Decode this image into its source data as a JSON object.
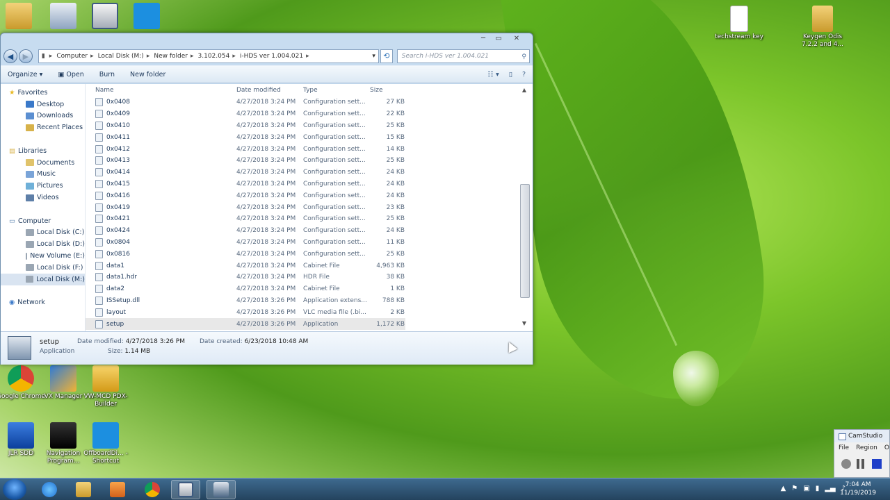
{
  "desktop": {
    "top_icons": [
      {
        "label": "",
        "icon": "user-folder-icon"
      },
      {
        "label": "",
        "icon": "printer-icon"
      },
      {
        "label": "",
        "icon": "camera-icon"
      },
      {
        "label": "",
        "icon": "e-app-icon"
      }
    ],
    "right_icons": [
      {
        "label": "techstream key",
        "icon": "text-file-icon"
      },
      {
        "label": "Keygen Odis 7.2.2 and 4...",
        "icon": "zip-folder-icon"
      }
    ],
    "left_icons": [
      {
        "label": "Google Chrome",
        "icon": "chrome-icon"
      },
      {
        "label": "VX Manager",
        "icon": "vx-manager-icon"
      },
      {
        "label": "VW-MCD PDX-Builder",
        "icon": "pdx-builder-icon"
      },
      {
        "label": "JLR SDD",
        "icon": "jlr-sdd-icon"
      },
      {
        "label": "Navigation Program...",
        "icon": "briefcase-icon"
      },
      {
        "label": "OffboardDi... - Shortcut",
        "icon": "offboard-icon"
      }
    ]
  },
  "explorer": {
    "window_controls": {
      "minimize": "─",
      "maximize": "▭",
      "close": "✕"
    },
    "breadcrumbs": [
      "Computer",
      "Local Disk (M:)",
      "New folder",
      "3.102.054",
      "i-HDS ver 1.004.021"
    ],
    "search_placeholder": "Search i-HDS ver 1.004.021",
    "toolbar": {
      "organize": "Organize",
      "open": "Open",
      "burn": "Burn",
      "new_folder": "New folder"
    },
    "nav": {
      "favorites": "Favorites",
      "favorites_items": [
        "Desktop",
        "Downloads",
        "Recent Places"
      ],
      "libraries": "Libraries",
      "libraries_items": [
        "Documents",
        "Music",
        "Pictures",
        "Videos"
      ],
      "computer": "Computer",
      "computer_items": [
        "Local Disk (C:)",
        "Local Disk (D:)",
        "New Volume (E:)",
        "Local Disk (F:)",
        "Local Disk (M:)"
      ],
      "network": "Network"
    },
    "columns": {
      "name": "Name",
      "date": "Date modified",
      "type": "Type",
      "size": "Size"
    },
    "files": [
      {
        "name": "0x0408",
        "date": "4/27/2018 3:24 PM",
        "type": "Configuration sett...",
        "size": "27 KB"
      },
      {
        "name": "0x0409",
        "date": "4/27/2018 3:24 PM",
        "type": "Configuration sett...",
        "size": "22 KB"
      },
      {
        "name": "0x0410",
        "date": "4/27/2018 3:24 PM",
        "type": "Configuration sett...",
        "size": "25 KB"
      },
      {
        "name": "0x0411",
        "date": "4/27/2018 3:24 PM",
        "type": "Configuration sett...",
        "size": "15 KB"
      },
      {
        "name": "0x0412",
        "date": "4/27/2018 3:24 PM",
        "type": "Configuration sett...",
        "size": "14 KB"
      },
      {
        "name": "0x0413",
        "date": "4/27/2018 3:24 PM",
        "type": "Configuration sett...",
        "size": "25 KB"
      },
      {
        "name": "0x0414",
        "date": "4/27/2018 3:24 PM",
        "type": "Configuration sett...",
        "size": "24 KB"
      },
      {
        "name": "0x0415",
        "date": "4/27/2018 3:24 PM",
        "type": "Configuration sett...",
        "size": "24 KB"
      },
      {
        "name": "0x0416",
        "date": "4/27/2018 3:24 PM",
        "type": "Configuration sett...",
        "size": "24 KB"
      },
      {
        "name": "0x0419",
        "date": "4/27/2018 3:24 PM",
        "type": "Configuration sett...",
        "size": "23 KB"
      },
      {
        "name": "0x0421",
        "date": "4/27/2018 3:24 PM",
        "type": "Configuration sett...",
        "size": "25 KB"
      },
      {
        "name": "0x0424",
        "date": "4/27/2018 3:24 PM",
        "type": "Configuration sett...",
        "size": "24 KB"
      },
      {
        "name": "0x0804",
        "date": "4/27/2018 3:24 PM",
        "type": "Configuration sett...",
        "size": "11 KB"
      },
      {
        "name": "0x0816",
        "date": "4/27/2018 3:24 PM",
        "type": "Configuration sett...",
        "size": "25 KB"
      },
      {
        "name": "data1",
        "date": "4/27/2018 3:24 PM",
        "type": "Cabinet File",
        "size": "4,963 KB"
      },
      {
        "name": "data1.hdr",
        "date": "4/27/2018 3:24 PM",
        "type": "HDR File",
        "size": "38 KB"
      },
      {
        "name": "data2",
        "date": "4/27/2018 3:24 PM",
        "type": "Cabinet File",
        "size": "1 KB"
      },
      {
        "name": "ISSetup.dll",
        "date": "4/27/2018 3:26 PM",
        "type": "Application extens...",
        "size": "788 KB"
      },
      {
        "name": "layout",
        "date": "4/27/2018 3:26 PM",
        "type": "VLC media file (.bi...",
        "size": "2 KB"
      },
      {
        "name": "setup",
        "date": "4/27/2018 3:26 PM",
        "type": "Application",
        "size": "1,172 KB"
      }
    ],
    "details": {
      "name": "setup",
      "type": "Application",
      "modified_label": "Date modified:",
      "modified_value": "4/27/2018 3:26 PM",
      "size_label": "Size:",
      "size_value": "1.14 MB",
      "created_label": "Date created:",
      "created_value": "6/23/2018 10:48 AM"
    }
  },
  "camstudio": {
    "title": "CamStudio",
    "menu": [
      "File",
      "Region",
      "O"
    ]
  },
  "taskbar": {
    "apps": [
      "ie-icon",
      "explorer-icon",
      "media-player-icon",
      "chrome-icon",
      "camstudio-icon",
      "setup-icon"
    ],
    "clock_time": "7:04 AM",
    "clock_date": "11/19/2019"
  },
  "colors": {
    "window_frame": "#c7dcf0",
    "taskbar": "#2f5473",
    "selection": "#d9e4f1"
  }
}
